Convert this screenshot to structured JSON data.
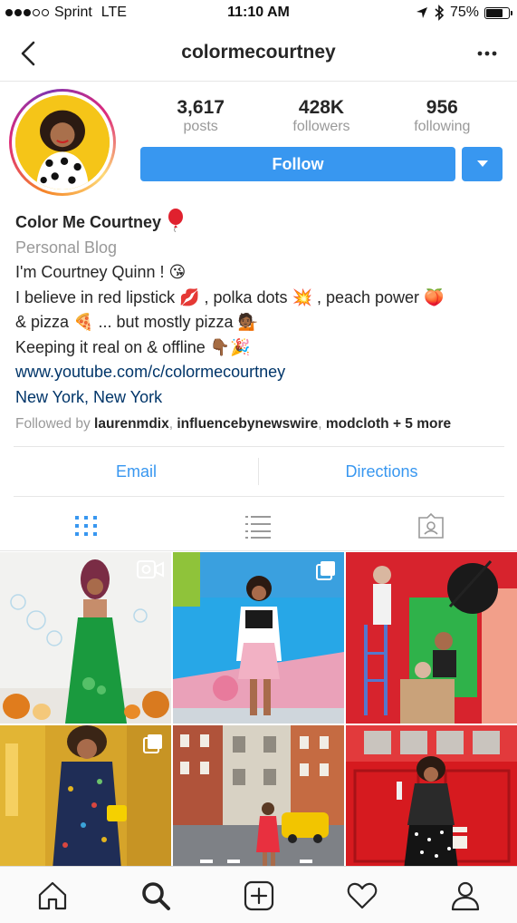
{
  "status_bar": {
    "carrier": "Sprint",
    "network": "LTE",
    "time": "11:10 AM",
    "battery": "75%",
    "battery_level": 0.75
  },
  "nav": {
    "title": "colormecourtney",
    "back_icon": "chevron-left-icon",
    "more_icon": "more-horizontal-icon"
  },
  "profile": {
    "stats": [
      {
        "value": "3,617",
        "label": "posts"
      },
      {
        "value": "428K",
        "label": "followers"
      },
      {
        "value": "956",
        "label": "following"
      }
    ],
    "follow_label": "Follow",
    "accent_color": "#3897f0"
  },
  "bio": {
    "name": "Color Me Courtney",
    "category": "Personal Blog",
    "lines": [
      "I'm Courtney Quinn ! 😘",
      "I believe in red lipstick 💋 , polka dots 💥 , peach power 🍑",
      "& pizza 🍕 ... but mostly pizza 💁🏾",
      "Keeping it real on & offline 👇🏾🎉"
    ],
    "website": "www.youtube.com/c/colormecourtney",
    "location": "New York, New York",
    "followed_by_prefix": "Followed by ",
    "followed_by_users": [
      "laurenmdix",
      "influencebynewswire",
      "modcloth"
    ],
    "followed_by_more": "+ 5 more"
  },
  "contact": {
    "email_label": "Email",
    "directions_label": "Directions"
  },
  "grid_tabs": [
    "grid-view-icon",
    "list-view-icon",
    "tagged-icon"
  ],
  "tab_bar": [
    "home-icon",
    "search-icon",
    "add-post-icon",
    "activity-heart-icon",
    "profile-icon"
  ]
}
